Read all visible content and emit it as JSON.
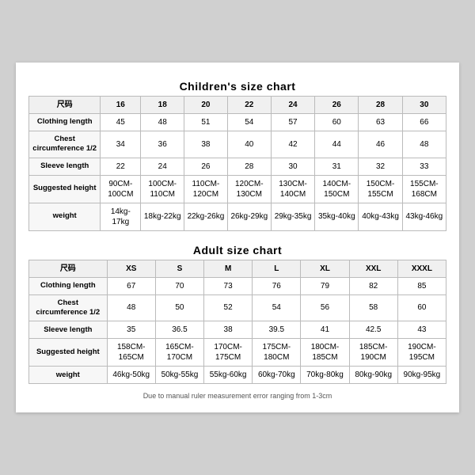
{
  "children_title": "Children's size chart",
  "adult_title": "Adult size chart",
  "note": "Due to manual ruler measurement error ranging from 1-3cm",
  "children": {
    "columns": [
      "尺码",
      "16",
      "18",
      "20",
      "22",
      "24",
      "26",
      "28",
      "30"
    ],
    "rows": [
      {
        "label": "Clothing length",
        "values": [
          "45",
          "48",
          "51",
          "54",
          "57",
          "60",
          "63",
          "66"
        ]
      },
      {
        "label": "Chest circumference 1/2",
        "values": [
          "34",
          "36",
          "38",
          "40",
          "42",
          "44",
          "46",
          "48"
        ]
      },
      {
        "label": "Sleeve length",
        "values": [
          "22",
          "24",
          "26",
          "28",
          "30",
          "31",
          "32",
          "33"
        ]
      },
      {
        "label": "Suggested height",
        "values": [
          "90CM-100CM",
          "100CM-110CM",
          "110CM-120CM",
          "120CM-130CM",
          "130CM-140CM",
          "140CM-150CM",
          "150CM-155CM",
          "155CM-168CM"
        ]
      },
      {
        "label": "weight",
        "values": [
          "14kg-17kg",
          "18kg-22kg",
          "22kg-26kg",
          "26kg-29kg",
          "29kg-35kg",
          "35kg-40kg",
          "40kg-43kg",
          "43kg-46kg"
        ]
      }
    ]
  },
  "adult": {
    "columns": [
      "尺码",
      "XS",
      "S",
      "M",
      "L",
      "XL",
      "XXL",
      "XXXL"
    ],
    "rows": [
      {
        "label": "Clothing length",
        "values": [
          "67",
          "70",
          "73",
          "76",
          "79",
          "82",
          "85"
        ]
      },
      {
        "label": "Chest circumference 1/2",
        "values": [
          "48",
          "50",
          "52",
          "54",
          "56",
          "58",
          "60"
        ]
      },
      {
        "label": "Sleeve length",
        "values": [
          "35",
          "36.5",
          "38",
          "39.5",
          "41",
          "42.5",
          "43"
        ]
      },
      {
        "label": "Suggested height",
        "values": [
          "158CM-165CM",
          "165CM-170CM",
          "170CM-175CM",
          "175CM-180CM",
          "180CM-185CM",
          "185CM-190CM",
          "190CM-195CM"
        ]
      },
      {
        "label": "weight",
        "values": [
          "46kg-50kg",
          "50kg-55kg",
          "55kg-60kg",
          "60kg-70kg",
          "70kg-80kg",
          "80kg-90kg",
          "90kg-95kg"
        ]
      }
    ]
  }
}
